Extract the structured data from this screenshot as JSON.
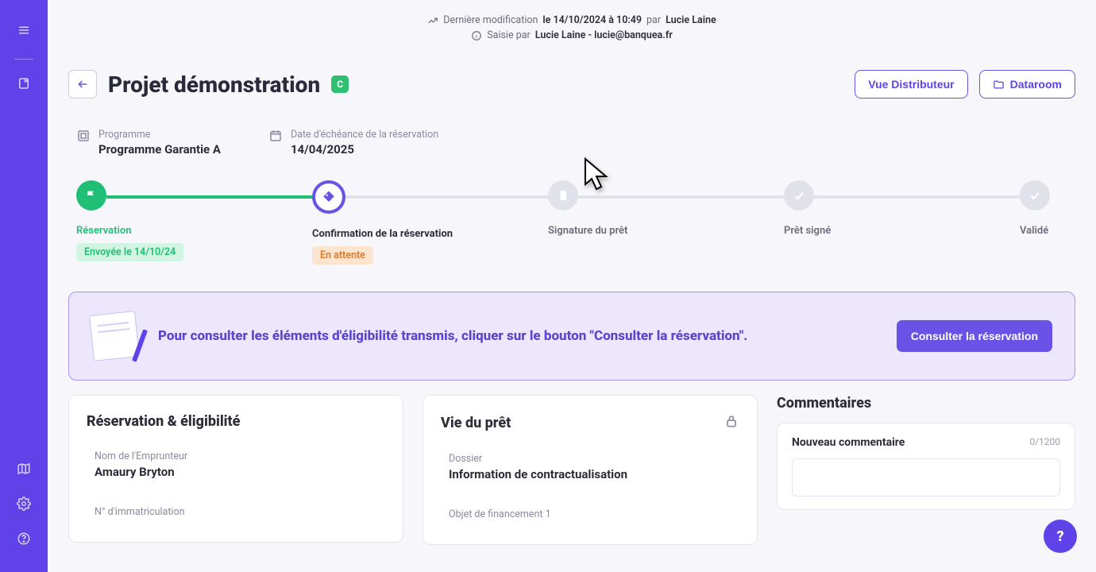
{
  "meta": {
    "modified_prefix": "Dernière modification",
    "modified_time": "le 14/10/2024 à 10:49",
    "modified_by_word": "par",
    "modified_by": "Lucie Laine",
    "entered_prefix": "Saisie par",
    "entered_by": "Lucie Laine - lucie@banquea.fr"
  },
  "header": {
    "title": "Projet démonstration",
    "project_badge": "C",
    "view_distributor": "Vue Distributeur",
    "dataroom": "Dataroom"
  },
  "info": {
    "program_label": "Programme",
    "program_value": "Programme Garantie A",
    "due_label": "Date d'échéance de la réservation",
    "due_value": "14/04/2025"
  },
  "steps": [
    {
      "label": "Réservation",
      "status": "done",
      "chip": "Envoyée le 14/10/24"
    },
    {
      "label": "Confirmation de la réservation",
      "status": "active",
      "chip": "En attente"
    },
    {
      "label": "Signature du prêt",
      "status": "pending",
      "chip": ""
    },
    {
      "label": "Prêt signé",
      "status": "pending",
      "chip": ""
    },
    {
      "label": "Validé",
      "status": "pending",
      "chip": ""
    }
  ],
  "callout": {
    "text": "Pour consulter les éléments d'éligibilité transmis, cliquer sur le bouton \"Consulter la réservation\".",
    "button": "Consulter la réservation"
  },
  "cards": {
    "reservation": {
      "title": "Réservation & éligibilité",
      "borrower_label": "Nom de l'Emprunteur",
      "borrower_value": "Amaury Bryton",
      "regnum_label": "N° d'immatriculation"
    },
    "loan": {
      "title": "Vie du prêt",
      "dossier_label": "Dossier",
      "dossier_value": "Information de contractualisation",
      "objet_label": "Objet de financement 1"
    }
  },
  "comments": {
    "title": "Commentaires",
    "new_label": "Nouveau commentaire",
    "counter": "0/1200"
  },
  "colors": {
    "primary": "#5f43e8",
    "success": "#1fbf75",
    "warning": "#d97a2b"
  }
}
